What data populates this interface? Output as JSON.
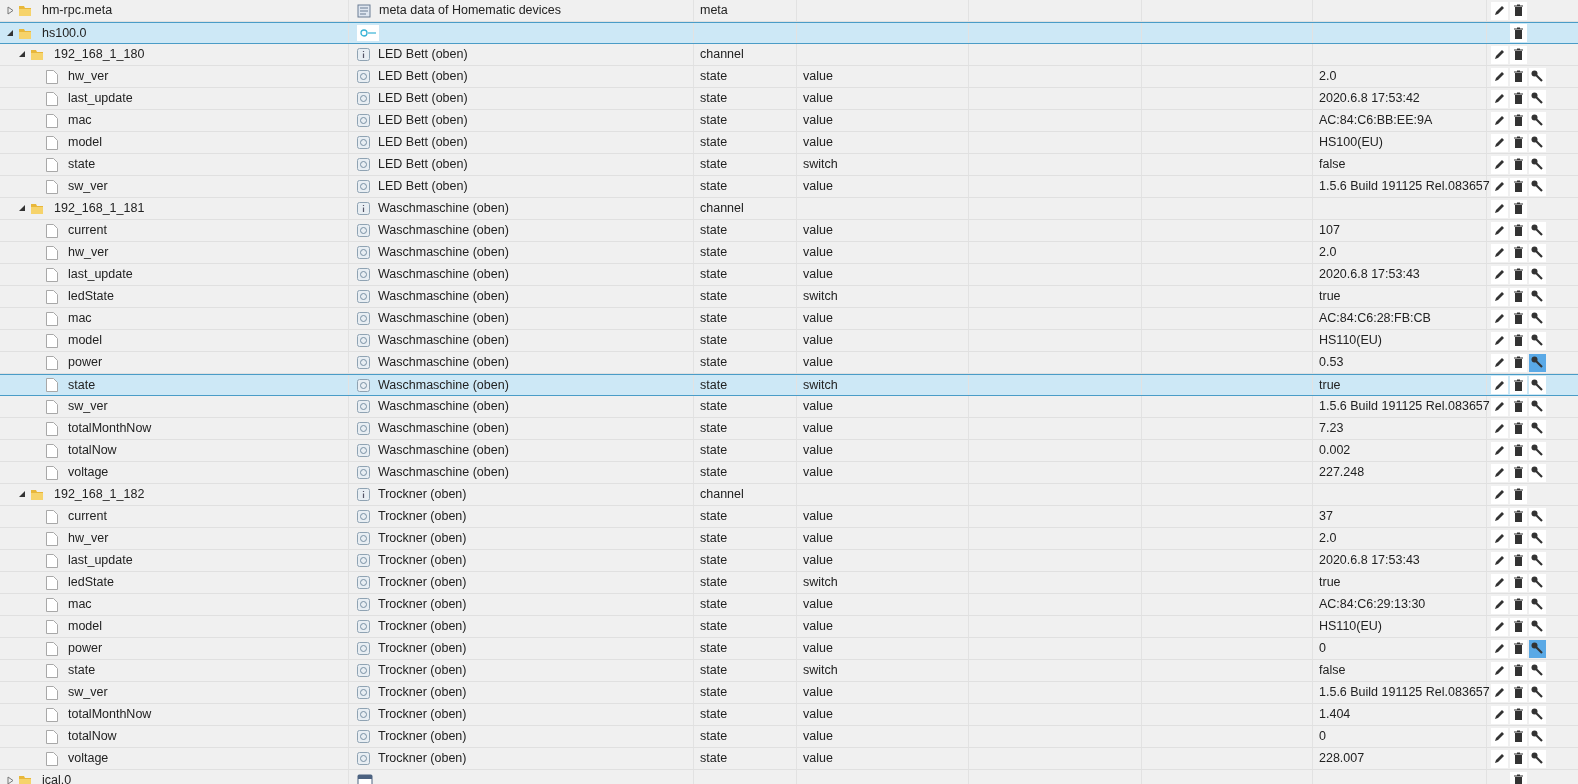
{
  "tree": [
    {
      "id": "hm-rpc.meta",
      "kind": "meta",
      "name": "meta data of Homematic devices",
      "type": "meta",
      "expanded": false,
      "selected": false
    },
    {
      "id": "hs100.0",
      "kind": "instance",
      "expanded": true,
      "selected": true,
      "children": [
        {
          "id": "192_168_1_180",
          "kind": "channel",
          "name": "LED Bett (oben)",
          "type": "channel",
          "expanded": true,
          "selected": false,
          "children": [
            {
              "id": "hw_ver",
              "kind": "state",
              "name": "LED Bett (oben)",
              "type": "state",
              "role": "value",
              "value": "2.0",
              "selected": false,
              "settings_active": false
            },
            {
              "id": "last_update",
              "kind": "state",
              "name": "LED Bett (oben)",
              "type": "state",
              "role": "value",
              "value": "2020.6.8 17:53:42",
              "selected": false,
              "settings_active": false
            },
            {
              "id": "mac",
              "kind": "state",
              "name": "LED Bett (oben)",
              "type": "state",
              "role": "value",
              "value": "AC:84:C6:BB:EE:9A",
              "selected": false,
              "settings_active": false
            },
            {
              "id": "model",
              "kind": "state",
              "name": "LED Bett (oben)",
              "type": "state",
              "role": "value",
              "value": "HS100(EU)",
              "selected": false,
              "settings_active": false
            },
            {
              "id": "state",
              "kind": "state",
              "name": "LED Bett (oben)",
              "type": "state",
              "role": "switch",
              "value": "false",
              "selected": false,
              "settings_active": false
            },
            {
              "id": "sw_ver",
              "kind": "state",
              "name": "LED Bett (oben)",
              "type": "state",
              "role": "value",
              "value": "1.5.6 Build 191125 Rel.083657",
              "selected": false,
              "settings_active": false
            }
          ]
        },
        {
          "id": "192_168_1_181",
          "kind": "channel",
          "name": "Waschmaschine (oben)",
          "type": "channel",
          "expanded": true,
          "selected": false,
          "children": [
            {
              "id": "current",
              "kind": "state",
              "name": "Waschmaschine (oben)",
              "type": "state",
              "role": "value",
              "value": "107",
              "selected": false,
              "settings_active": false
            },
            {
              "id": "hw_ver",
              "kind": "state",
              "name": "Waschmaschine (oben)",
              "type": "state",
              "role": "value",
              "value": "2.0",
              "selected": false,
              "settings_active": false
            },
            {
              "id": "last_update",
              "kind": "state",
              "name": "Waschmaschine (oben)",
              "type": "state",
              "role": "value",
              "value": "2020.6.8 17:53:43",
              "selected": false,
              "settings_active": false
            },
            {
              "id": "ledState",
              "kind": "state",
              "name": "Waschmaschine (oben)",
              "type": "state",
              "role": "switch",
              "value": "true",
              "selected": false,
              "settings_active": false
            },
            {
              "id": "mac",
              "kind": "state",
              "name": "Waschmaschine (oben)",
              "type": "state",
              "role": "value",
              "value": "AC:84:C6:28:FB:CB",
              "selected": false,
              "settings_active": false
            },
            {
              "id": "model",
              "kind": "state",
              "name": "Waschmaschine (oben)",
              "type": "state",
              "role": "value",
              "value": "HS110(EU)",
              "selected": false,
              "settings_active": false
            },
            {
              "id": "power",
              "kind": "state",
              "name": "Waschmaschine (oben)",
              "type": "state",
              "role": "value",
              "value": "0.53",
              "selected": false,
              "settings_active": true
            },
            {
              "id": "state",
              "kind": "state",
              "name": "Waschmaschine (oben)",
              "type": "state",
              "role": "switch",
              "value": "true",
              "selected": true,
              "settings_active": false
            },
            {
              "id": "sw_ver",
              "kind": "state",
              "name": "Waschmaschine (oben)",
              "type": "state",
              "role": "value",
              "value": "1.5.6 Build 191125 Rel.083657",
              "selected": false,
              "settings_active": false
            },
            {
              "id": "totalMonthNow",
              "kind": "state",
              "name": "Waschmaschine (oben)",
              "type": "state",
              "role": "value",
              "value": "7.23",
              "selected": false,
              "settings_active": false
            },
            {
              "id": "totalNow",
              "kind": "state",
              "name": "Waschmaschine (oben)",
              "type": "state",
              "role": "value",
              "value": "0.002",
              "selected": false,
              "settings_active": false
            },
            {
              "id": "voltage",
              "kind": "state",
              "name": "Waschmaschine (oben)",
              "type": "state",
              "role": "value",
              "value": "227.248",
              "selected": false,
              "settings_active": false
            }
          ]
        },
        {
          "id": "192_168_1_182",
          "kind": "channel",
          "name": "Trockner (oben)",
          "type": "channel",
          "expanded": true,
          "selected": false,
          "children": [
            {
              "id": "current",
              "kind": "state",
              "name": "Trockner (oben)",
              "type": "state",
              "role": "value",
              "value": "37",
              "selected": false,
              "settings_active": false
            },
            {
              "id": "hw_ver",
              "kind": "state",
              "name": "Trockner (oben)",
              "type": "state",
              "role": "value",
              "value": "2.0",
              "selected": false,
              "settings_active": false
            },
            {
              "id": "last_update",
              "kind": "state",
              "name": "Trockner (oben)",
              "type": "state",
              "role": "value",
              "value": "2020.6.8 17:53:43",
              "selected": false,
              "settings_active": false
            },
            {
              "id": "ledState",
              "kind": "state",
              "name": "Trockner (oben)",
              "type": "state",
              "role": "switch",
              "value": "true",
              "selected": false,
              "settings_active": false
            },
            {
              "id": "mac",
              "kind": "state",
              "name": "Trockner (oben)",
              "type": "state",
              "role": "value",
              "value": "AC:84:C6:29:13:30",
              "selected": false,
              "settings_active": false
            },
            {
              "id": "model",
              "kind": "state",
              "name": "Trockner (oben)",
              "type": "state",
              "role": "value",
              "value": "HS110(EU)",
              "selected": false,
              "settings_active": false
            },
            {
              "id": "power",
              "kind": "state",
              "name": "Trockner (oben)",
              "type": "state",
              "role": "value",
              "value": "0",
              "selected": false,
              "settings_active": true
            },
            {
              "id": "state",
              "kind": "state",
              "name": "Trockner (oben)",
              "type": "state",
              "role": "switch",
              "value": "false",
              "selected": false,
              "settings_active": false
            },
            {
              "id": "sw_ver",
              "kind": "state",
              "name": "Trockner (oben)",
              "type": "state",
              "role": "value",
              "value": "1.5.6 Build 191125 Rel.083657",
              "selected": false,
              "settings_active": false
            },
            {
              "id": "totalMonthNow",
              "kind": "state",
              "name": "Trockner (oben)",
              "type": "state",
              "role": "value",
              "value": "1.404",
              "selected": false,
              "settings_active": false
            },
            {
              "id": "totalNow",
              "kind": "state",
              "name": "Trockner (oben)",
              "type": "state",
              "role": "value",
              "value": "0",
              "selected": false,
              "settings_active": false
            },
            {
              "id": "voltage",
              "kind": "state",
              "name": "Trockner (oben)",
              "type": "state",
              "role": "value",
              "value": "228.007",
              "selected": false,
              "settings_active": false
            }
          ]
        }
      ]
    },
    {
      "id": "ical.0",
      "kind": "calendar",
      "expanded": false,
      "selected": false
    }
  ]
}
